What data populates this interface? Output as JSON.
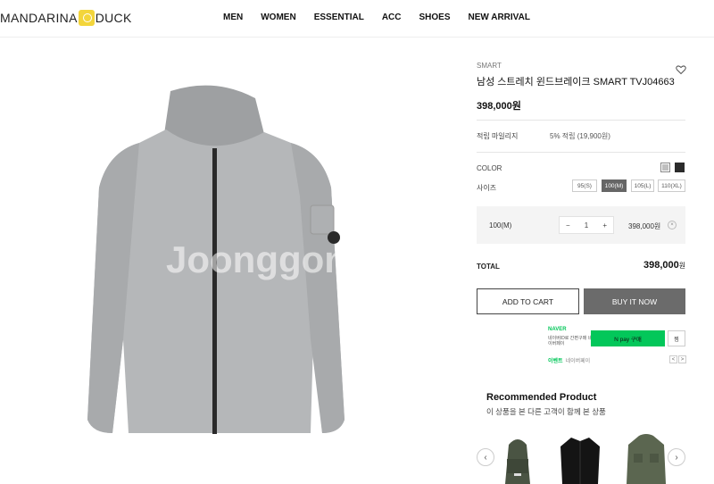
{
  "header": {
    "logo_left": "MANDARINA",
    "logo_right": "DUCK",
    "nav": [
      "MEN",
      "WOMEN",
      "ESSENTIAL",
      "ACC",
      "SHOES",
      "NEW ARRIVAL"
    ]
  },
  "product": {
    "brand": "SMART",
    "title": "남성 스트레치 윈드브레이크 SMART TVJ04663",
    "price": "398,000원",
    "image_watermark": "Joonggonara",
    "color_label": "COLOR",
    "colors": [
      "#bfbfbf",
      "#2b2b2b"
    ],
    "points_label": "적립 마일리지",
    "points_value": "5% 적립 (19,900원)",
    "size_label": "사이즈",
    "sizes": [
      "95(S)",
      "100(M)",
      "105(L)",
      "110(XL)"
    ],
    "selected_size": "100(M)"
  },
  "selection": {
    "option": "100(M)",
    "minus": "−",
    "qty": "1",
    "plus": "+",
    "price": "398,000원",
    "remove": "×"
  },
  "total": {
    "label": "TOTAL",
    "value": "398,000",
    "unit": "원"
  },
  "buttons": {
    "cart": "ADD TO CART",
    "buy": "BUY IT NOW"
  },
  "naver": {
    "logo": "NAVER",
    "sub": "네이버ID로 간편구매 네이버페이",
    "pay": "N pay 구매",
    "zzim": "찜",
    "event": "이벤트",
    "event_sub": "네이버페이",
    "prev": "<",
    "next": ">"
  },
  "recommended": {
    "title": "Recommended Product",
    "subtitle": "이 상품을 본 다른 고객이 함께 본 상품",
    "prev": "‹",
    "next": "›"
  }
}
